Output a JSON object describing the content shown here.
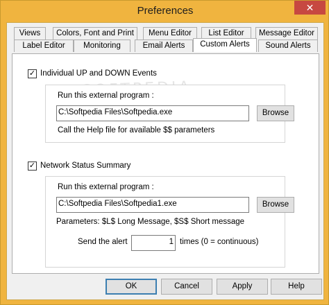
{
  "window": {
    "title": "Preferences",
    "close_glyph": "✕"
  },
  "tabs": {
    "row1": [
      "Views",
      "Colors, Font and Print",
      "Menu Editor",
      "List Editor",
      "Message Editor"
    ],
    "row2": [
      "Label Editor",
      "Monitoring",
      "Email Alerts",
      "Custom Alerts",
      "Sound Alerts"
    ],
    "active": "Custom Alerts"
  },
  "section1": {
    "checkbox_label": "Individual UP and DOWN Events",
    "checked": true,
    "run_label": "Run this external program :",
    "program_value": "C:\\Softpedia Files\\Softpedia.exe",
    "browse_label": "Browse",
    "help_text": "Call the Help file for available $$ parameters"
  },
  "section2": {
    "checkbox_label": "Network Status Summary",
    "checked": true,
    "run_label": "Run this external program :",
    "program_value": "C:\\Softpedia Files\\Softpedia1.exe",
    "browse_label": "Browse",
    "params_text": "Parameters: $L$ Long Message, $S$ Short message",
    "send_label": "Send the alert",
    "send_value": "1",
    "times_label": "times (0 = continuous)"
  },
  "footer": {
    "ok": "OK",
    "cancel": "Cancel",
    "apply": "Apply",
    "help": "Help"
  },
  "watermark": "SOFTPEDIA",
  "colors": {
    "titlebar": "#f0b43f",
    "close": "#c74841"
  }
}
